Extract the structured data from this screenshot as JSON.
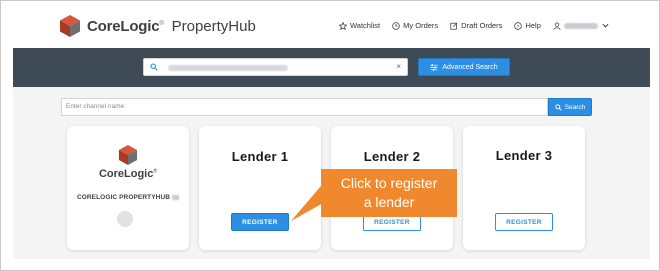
{
  "header": {
    "brand": "CoreLogic",
    "brand_tm": "®",
    "product": "PropertyHub",
    "nav": {
      "watchlist": "Watchlist",
      "my_orders": "My Orders",
      "draft_orders": "Draft Orders",
      "help": "Help"
    }
  },
  "search": {
    "advanced_label": "Advanced Search",
    "clear_glyph": "×"
  },
  "channel_search": {
    "placeholder": "Enter channel name",
    "button_label": "Search"
  },
  "cards": {
    "corelogic": {
      "logo_word": "CoreLogic",
      "logo_tm": "®",
      "name": "CORELOGIC PROPERTYHUB"
    },
    "lenders": [
      {
        "title": "Lender 1",
        "button": "REGISTER",
        "style": "primary"
      },
      {
        "title": "Lender 2",
        "button": "REGISTER",
        "style": "outline"
      },
      {
        "title": "Lender 3",
        "button": "REGISTER",
        "style": "outline"
      }
    ]
  },
  "callout": {
    "line1": "Click to register",
    "line2": "a lender"
  },
  "colors": {
    "accent": "#2c8fe3",
    "band": "#3e4a56",
    "callout": "#f0882d",
    "logo_red": "#c8412a"
  }
}
